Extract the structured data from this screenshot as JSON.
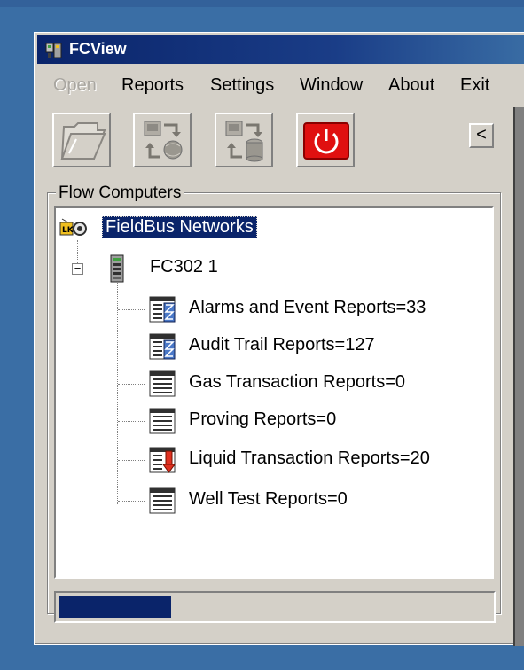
{
  "window": {
    "title": "FCView"
  },
  "menu": [
    {
      "label": "Open",
      "enabled": false
    },
    {
      "label": "Reports",
      "enabled": true
    },
    {
      "label": "Settings",
      "enabled": true
    },
    {
      "label": "Window",
      "enabled": true
    },
    {
      "label": "About",
      "enabled": true
    },
    {
      "label": "Exit",
      "enabled": true
    }
  ],
  "toolbar": {
    "buttons": [
      {
        "name": "open-folder",
        "icon": "folder-icon"
      },
      {
        "name": "network-transfer",
        "icon": "network-transfer-icon"
      },
      {
        "name": "database-transfer",
        "icon": "database-transfer-icon"
      },
      {
        "name": "power",
        "icon": "power-icon",
        "color": "#e01010"
      }
    ],
    "collapse_label": "<"
  },
  "group": {
    "label": "Flow Computers"
  },
  "tree": {
    "root": "FieldBus Networks",
    "device": "FC302 1",
    "reports": [
      {
        "label": "Alarms and Event Reports=33",
        "icon": "hourglass-report-icon"
      },
      {
        "label": "Audit Trail Reports=127",
        "icon": "hourglass-report-icon"
      },
      {
        "label": "Gas Transaction Reports=0",
        "icon": "report-icon"
      },
      {
        "label": "Proving Reports=0",
        "icon": "report-icon"
      },
      {
        "label": "Liquid Transaction Reports=20",
        "icon": "download-report-icon"
      },
      {
        "label": "Well Test Reports=0",
        "icon": "report-icon"
      }
    ]
  },
  "status": {
    "progress": 0.26,
    "progress_color": "#0a246a"
  },
  "colors": {
    "titlebar": "#0a246a",
    "selection": "#0a246a",
    "face": "#d4d0c8",
    "desktop": "#3a6ea5"
  }
}
